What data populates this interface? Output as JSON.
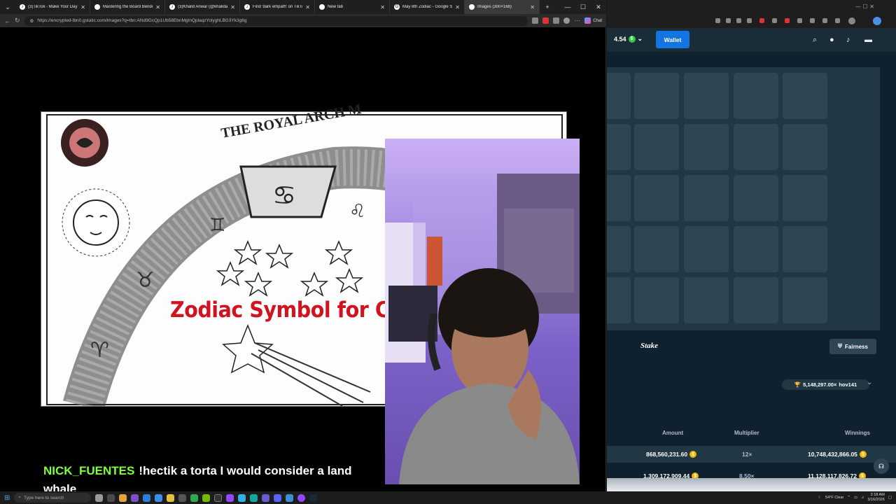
{
  "browser": {
    "tabs": [
      {
        "title": "(3)TikTok - Make Your Day"
      },
      {
        "title": "Mastering the Board Bender"
      },
      {
        "title": "(3)Khalid Anwar (@khalidan..."
      },
      {
        "title": "Find 'dark empath' on TikTo..."
      },
      {
        "title": "New tab"
      },
      {
        "title": "May 8th Zodiac - Google Se..."
      },
      {
        "title": "Images (300×168)"
      }
    ],
    "url": "https://encrypted-tbn0.gstatic.com/images?q=tbn:ANd9GcQp1Ub58EbnMgtnQplaqzYolyghLBG3Yk3g8g",
    "chat_label": "Chat"
  },
  "image": {
    "arch_text": "THE ROYAL ARCH",
    "arch_extra": "M",
    "caption": "Zodiac Symbol for Can"
  },
  "stream_chat": {
    "username": "NICK_FUENTES",
    "message": "!hectik a torta I would consider a land whale"
  },
  "stake": {
    "balance": "4.54",
    "wallet_label": "Wallet",
    "logo": "Stake",
    "fairness_label": "Fairness",
    "jackpot": "5,148,297.00×",
    "jackpot_user": "hov141",
    "columns": [
      "Amount",
      "Multiplier",
      "Winnings"
    ],
    "rows": [
      {
        "amount": "868,560,231.60",
        "multiplier": "12×",
        "winnings": "10,748,432,866.05"
      },
      {
        "amount": "1,309,172,909.44",
        "multiplier": "8.50×",
        "winnings": "11,128,117,826.72"
      }
    ],
    "colors": {
      "bg": "#0f212e",
      "accent": "#1475e1",
      "tile": "#2f4553"
    }
  },
  "taskbar": {
    "search_placeholder": "Type here to search",
    "weather": "54°F Clear",
    "time": "2:18 AM",
    "date": "3/16/2026"
  }
}
